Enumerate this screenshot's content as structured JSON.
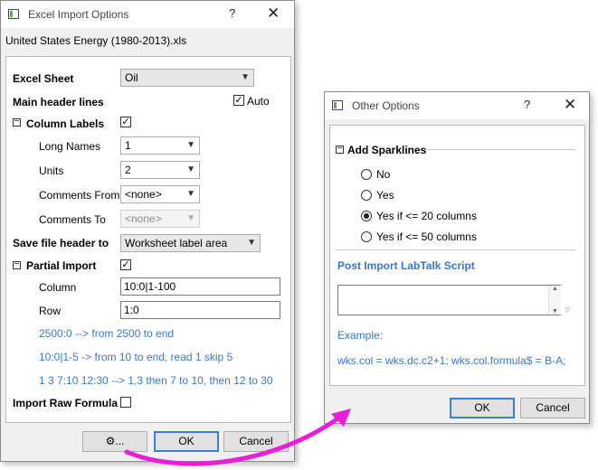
{
  "excel_dialog": {
    "title": "Excel Import Options",
    "help": "?",
    "close": "✕",
    "file_name": "United States Energy (1980-2013).xls",
    "excel_sheet": {
      "label": "Excel Sheet",
      "value": "Oil"
    },
    "main_header_lines": {
      "label": "Main header lines",
      "auto_label": "Auto",
      "auto_checked": true
    },
    "column_labels": {
      "label": "Column Labels",
      "expanded": true,
      "checked": true,
      "long_names": {
        "label": "Long Names",
        "value": "1"
      },
      "units": {
        "label": "Units",
        "value": "2"
      },
      "comments_from": {
        "label": "Comments From",
        "value": "<none>"
      },
      "comments_to": {
        "label": "Comments To",
        "value": "<none>"
      }
    },
    "save_file_header": {
      "label": "Save file header to",
      "value": "Worksheet label area"
    },
    "partial_import": {
      "label": "Partial Import",
      "expanded": true,
      "checked": true,
      "column": {
        "label": "Column",
        "value": "10:0|1-100"
      },
      "row": {
        "label": "Row",
        "value": "1:0"
      },
      "hints": [
        "2500:0 --> from 2500 to end",
        "10:0|1-5 -> from 10 to end, read 1 skip 5",
        "1 3 7:10 12:30 --> 1,3 then 7 to 10, then 12 to 30"
      ]
    },
    "import_raw_formula": {
      "label": "Import Raw Formula",
      "checked": false
    },
    "buttons": {
      "options": "⚙...",
      "ok": "OK",
      "cancel": "Cancel"
    }
  },
  "other_dialog": {
    "title": "Other Options",
    "help": "?",
    "close": "✕",
    "add_sparklines": {
      "label": "Add Sparklines",
      "options": [
        "No",
        "Yes",
        "Yes if <= 20 columns",
        "Yes if <= 50 columns"
      ],
      "selected_index": 2
    },
    "script_label": "Post Import LabTalk Script",
    "script_value": "",
    "example_label": "Example:",
    "example_text": "wks.col = wks.dc.c2+1; wks.col.formula$ = B-A;",
    "buttons": {
      "ok": "OK",
      "cancel": "Cancel"
    }
  },
  "colors": {
    "accent": "#3a78c4",
    "arrow": "#e81fd8"
  }
}
